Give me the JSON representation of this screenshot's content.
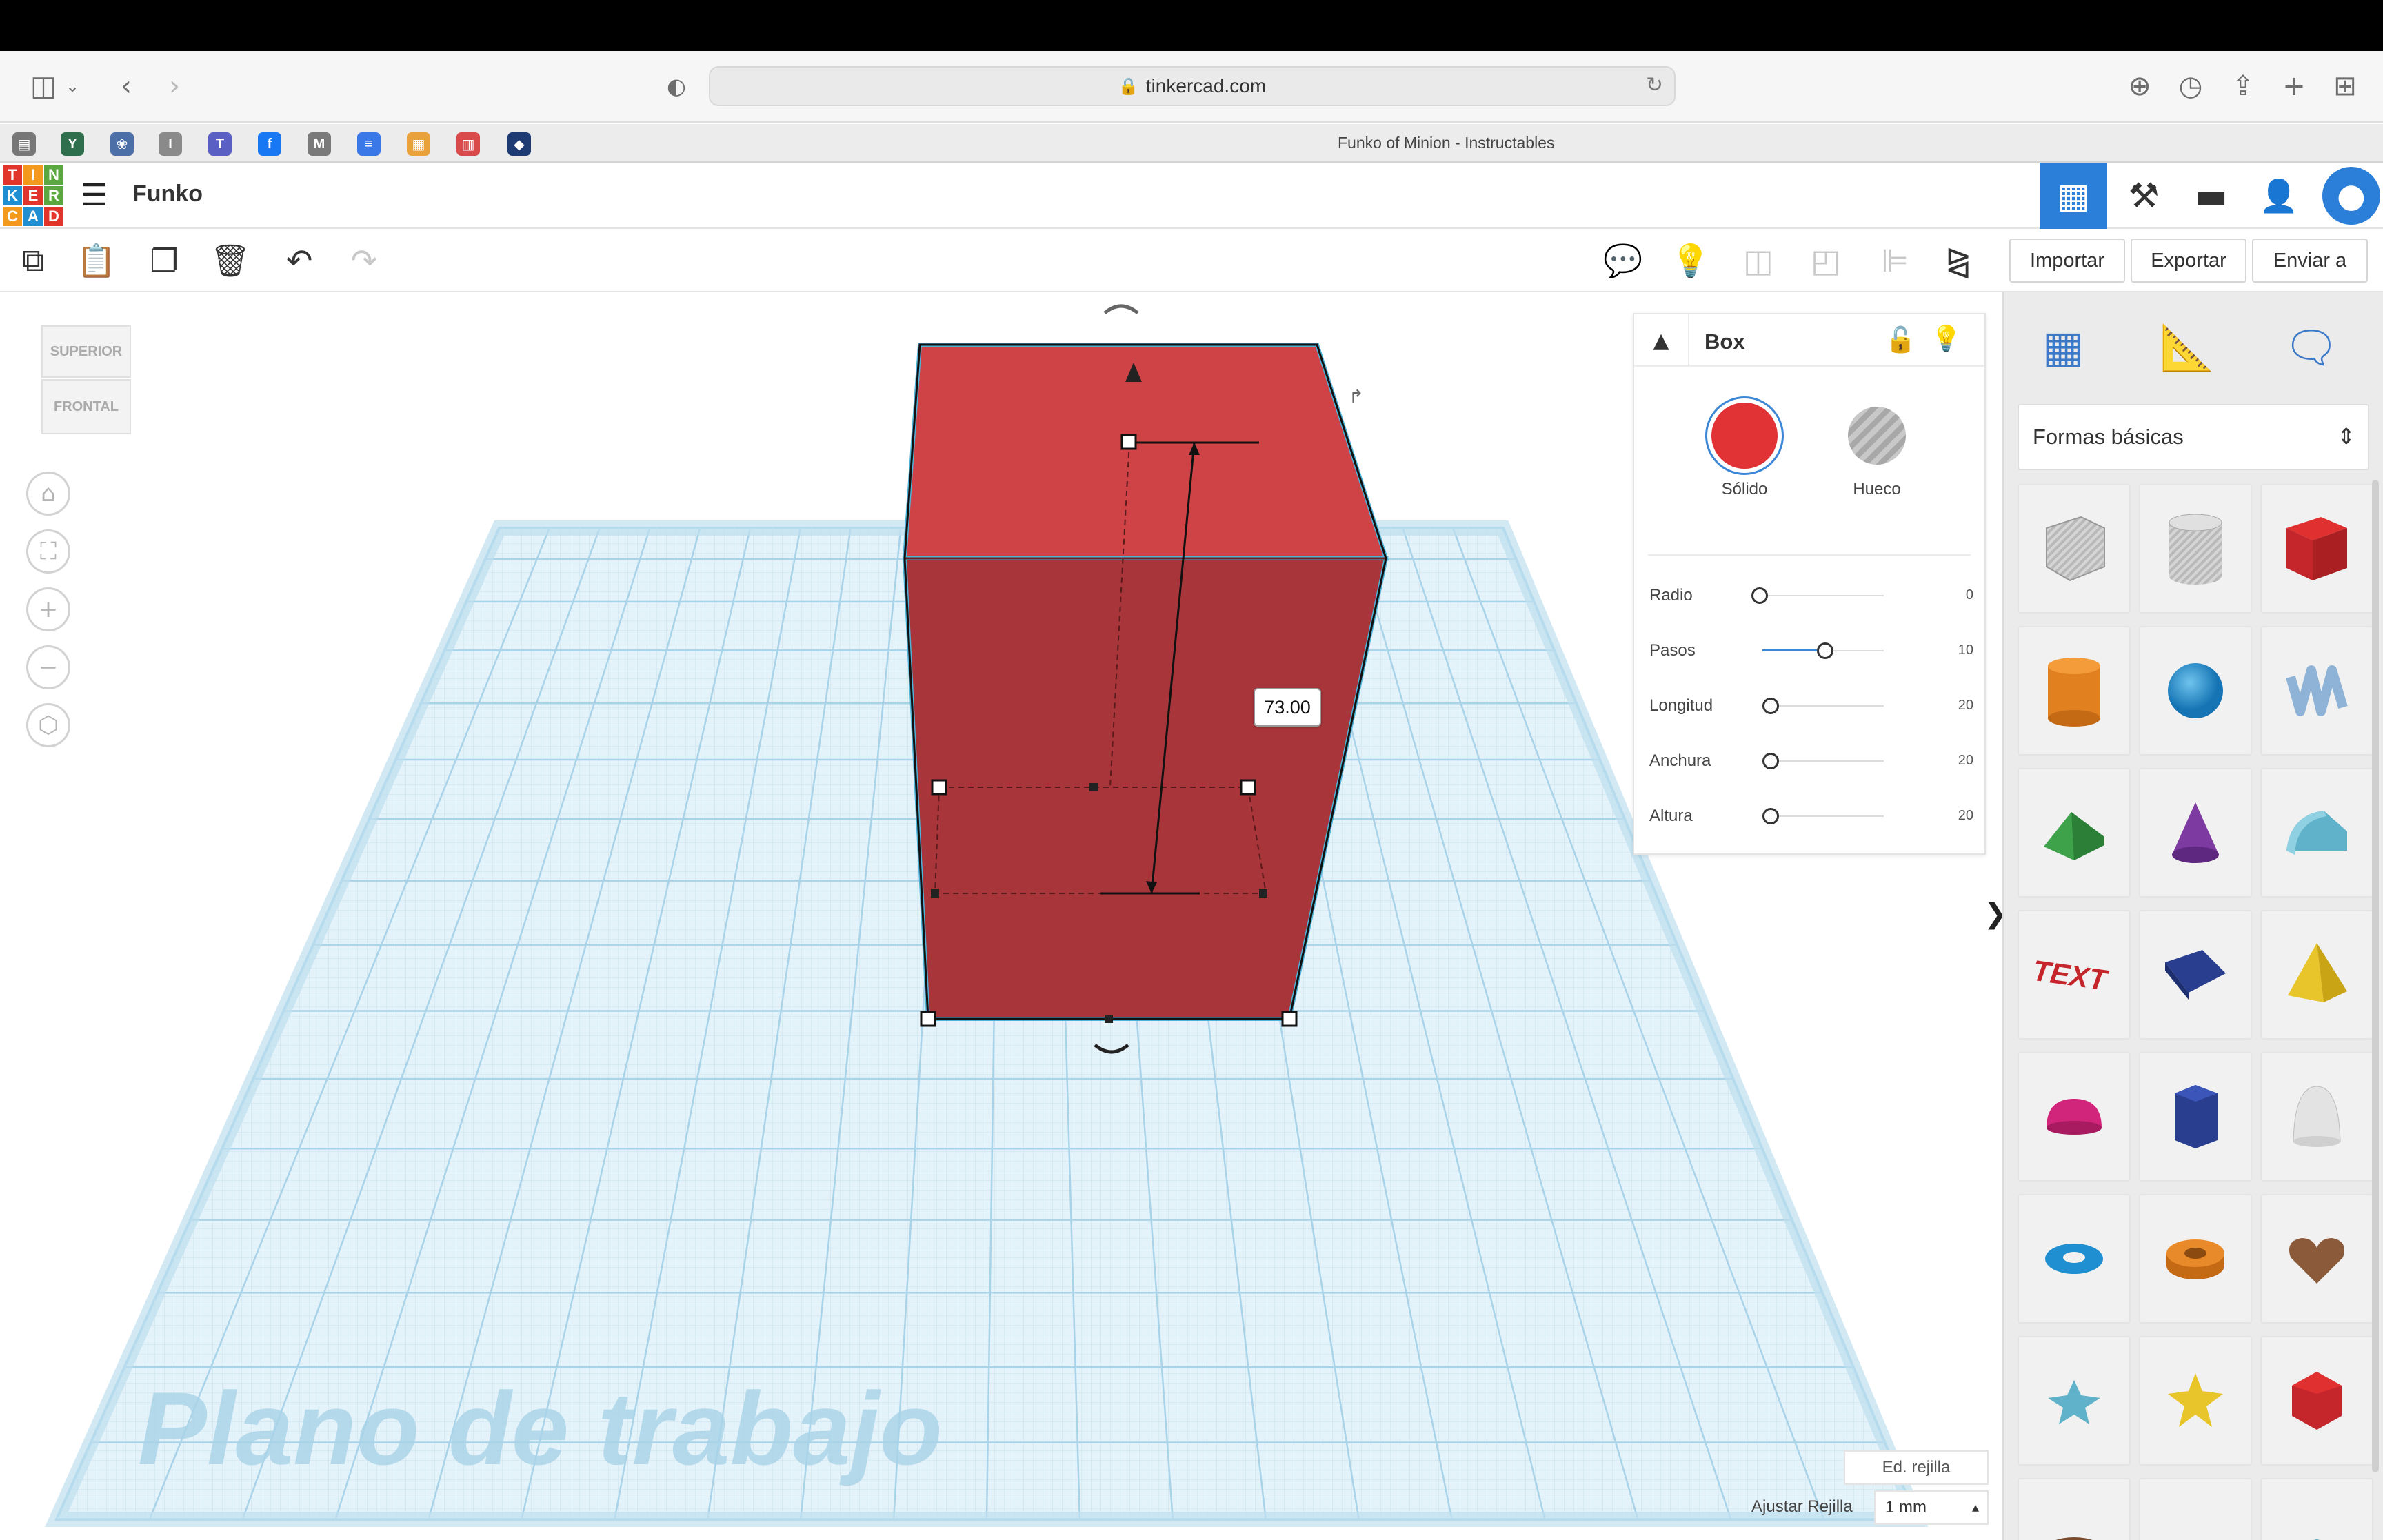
{
  "browser": {
    "url": "tinkercad.com",
    "tab_title": "Funko of Minion - Instructables",
    "favorites": [
      {
        "icon": "bookmark-icon-1",
        "color": "#777777",
        "glyph": "▤"
      },
      {
        "icon": "bookmark-icon-2",
        "color": "#2f6f4e",
        "glyph": "Y"
      },
      {
        "icon": "bookmark-icon-3",
        "color": "#4d6fa8",
        "glyph": "❀"
      },
      {
        "icon": "bookmark-icon-4",
        "color": "#8a8a8a",
        "glyph": "I"
      },
      {
        "icon": "bookmark-icon-5",
        "color": "#5a5fc4",
        "glyph": "T"
      },
      {
        "icon": "facebook-icon",
        "color": "#1877f2",
        "glyph": "f"
      },
      {
        "icon": "bookmark-icon-7",
        "color": "#7a7a7a",
        "glyph": "M"
      },
      {
        "icon": "docs-icon",
        "color": "#3b78e7",
        "glyph": "≡"
      },
      {
        "icon": "tinkercad-icon",
        "color": "#e9a23b",
        "glyph": "▦"
      },
      {
        "icon": "bookmark-icon-10",
        "color": "#d94a4a",
        "glyph": "▥"
      },
      {
        "icon": "bookmark-icon-11",
        "color": "#1f3b73",
        "glyph": "◆"
      }
    ]
  },
  "app": {
    "logo_letters": [
      "T",
      "I",
      "N",
      "K",
      "E",
      "R",
      "C",
      "A",
      "D"
    ],
    "logo_colors": [
      "#e1342a",
      "#f39a1e",
      "#5aa83f",
      "#1f8fd1",
      "#e1342a",
      "#5aa83f",
      "#f39a1e",
      "#1f8fd1",
      "#e1342a"
    ],
    "design_name": "Funko"
  },
  "toolbar": {
    "import_label": "Importar",
    "export_label": "Exportar",
    "send_label": "Enviar a"
  },
  "viewport": {
    "view_cube_top": "SUPERIOR",
    "view_cube_front": "FRONTAL",
    "workplane_label": "Plano de trabajo",
    "dimension_value": "73.00",
    "edit_grid_label": "Ed. rejilla",
    "snap_grid_label": "Ajustar Rejilla",
    "snap_grid_value": "1 mm",
    "shape_color": "#c4393d",
    "grid_color": "#bfe0ef"
  },
  "inspector": {
    "title": "Box",
    "solid_label": "Sólido",
    "hole_label": "Hueco",
    "solid_color": "#e13336",
    "props": [
      {
        "name": "Radio",
        "value": "0",
        "fraction": 0.0
      },
      {
        "name": "Pasos",
        "value": "10",
        "fraction": 0.45
      },
      {
        "name": "Longitud",
        "value": "20",
        "fraction": 0.0
      },
      {
        "name": "Anchura",
        "value": "20",
        "fraction": 0.0
      },
      {
        "name": "Altura",
        "value": "20",
        "fraction": 0.0
      }
    ]
  },
  "shapes_panel": {
    "category": "Formas básicas",
    "shapes": [
      {
        "name": "box-hole-shape"
      },
      {
        "name": "cylinder-hole-shape"
      },
      {
        "name": "box-shape"
      },
      {
        "name": "cylinder-shape"
      },
      {
        "name": "sphere-shape"
      },
      {
        "name": "scribble-shape"
      },
      {
        "name": "roof-shape"
      },
      {
        "name": "cone-shape"
      },
      {
        "name": "round-roof-shape"
      },
      {
        "name": "text-shape",
        "text": "TEXT"
      },
      {
        "name": "wedge-shape"
      },
      {
        "name": "pyramid-shape"
      },
      {
        "name": "half-sphere-shape"
      },
      {
        "name": "polygon-shape"
      },
      {
        "name": "paraboloid-shape"
      },
      {
        "name": "torus-shape"
      },
      {
        "name": "tube-shape"
      },
      {
        "name": "heart-shape"
      },
      {
        "name": "star-shape"
      },
      {
        "name": "star-yellow-shape"
      },
      {
        "name": "icosahedron-shape"
      },
      {
        "name": "ring-shape"
      },
      {
        "name": "cylinder-hole-2-shape"
      },
      {
        "name": "diamond-shape"
      }
    ]
  }
}
